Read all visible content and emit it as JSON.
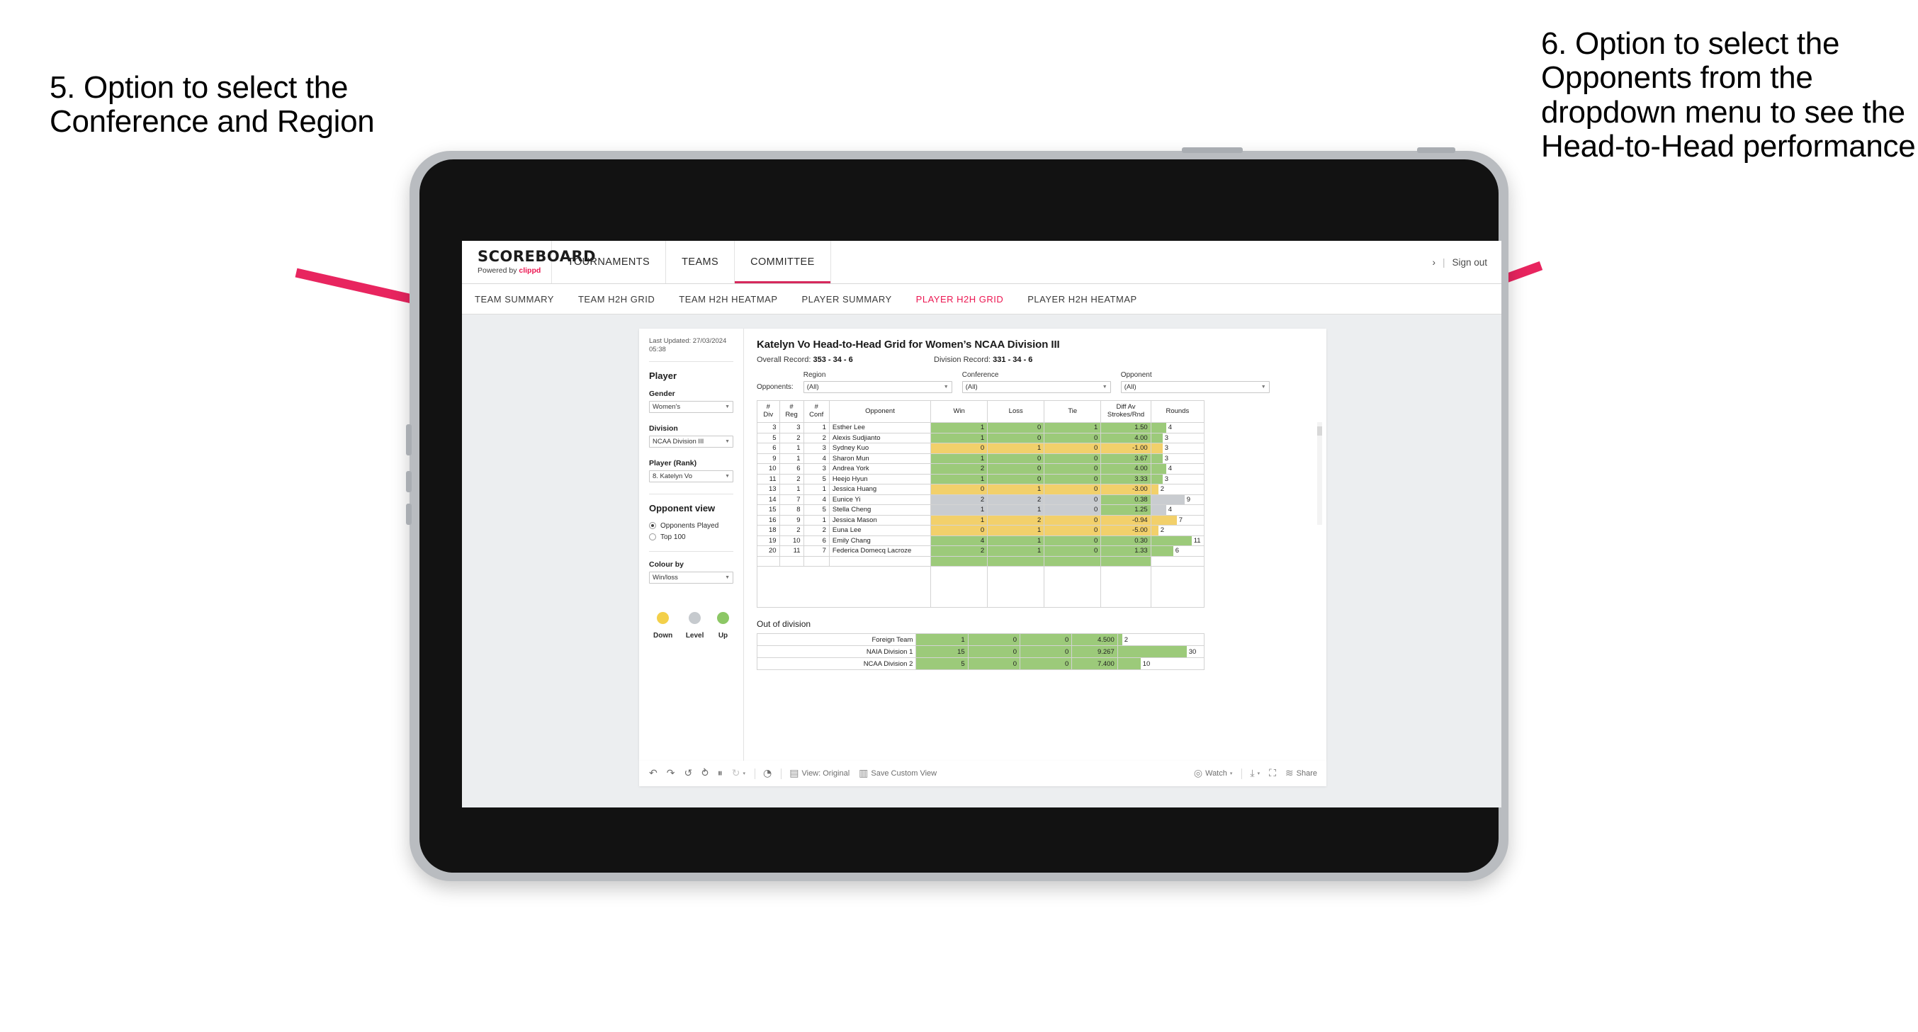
{
  "annotations": {
    "left": "5. Option to select the Conference and Region",
    "right": "6. Option to select the Opponents from the dropdown menu to see the Head-to-Head performance",
    "arrow_color": "#E8255F"
  },
  "app": {
    "logo": {
      "name": "SCOREBOARD",
      "powered_prefix": "Powered by ",
      "powered_brand": "clippd"
    },
    "topnav": [
      {
        "label": "TOURNAMENTS",
        "active": false
      },
      {
        "label": "TEAMS",
        "active": false
      },
      {
        "label": "COMMITTEE",
        "active": true
      }
    ],
    "account": {
      "chevron": "›",
      "separator": "|",
      "sign_out": "Sign out"
    },
    "subnav": [
      {
        "label": "TEAM SUMMARY",
        "active": false
      },
      {
        "label": "TEAM H2H GRID",
        "active": false
      },
      {
        "label": "TEAM H2H HEATMAP",
        "active": false
      },
      {
        "label": "PLAYER SUMMARY",
        "active": false
      },
      {
        "label": "PLAYER H2H GRID",
        "active": true
      },
      {
        "label": "PLAYER H2H HEATMAP",
        "active": false
      }
    ]
  },
  "sidebar": {
    "last_updated": "Last Updated: 27/03/2024 05:38",
    "player_heading": "Player",
    "gender": {
      "label": "Gender",
      "value": "Women's"
    },
    "division": {
      "label": "Division",
      "value": "NCAA Division III"
    },
    "player_rank": {
      "label": "Player (Rank)",
      "value": "8. Katelyn Vo"
    },
    "opponent_view": {
      "heading": "Opponent view",
      "options": [
        {
          "label": "Opponents Played",
          "selected": true
        },
        {
          "label": "Top 100",
          "selected": false
        }
      ]
    },
    "colour_by": {
      "label": "Colour by",
      "value": "Win/loss"
    },
    "legend": [
      {
        "label": "Down",
        "color": "#F3D04A"
      },
      {
        "label": "Level",
        "color": "#C6CACE"
      },
      {
        "label": "Up",
        "color": "#8CC765"
      }
    ]
  },
  "main": {
    "title": "Katelyn Vo Head-to-Head Grid for Women’s NCAA Division III",
    "overall_record_label": "Overall Record:",
    "overall_record_value": "353 - 34 - 6",
    "division_record_label": "Division Record:",
    "division_record_value": "331 -  34 - 6",
    "filters": {
      "prefix_label": "Opponents:",
      "fields": [
        {
          "title": "Region",
          "value": "(All)"
        },
        {
          "title": "Conference",
          "value": "(All)"
        },
        {
          "title": "Opponent",
          "value": "(All)"
        }
      ]
    },
    "out_of_division_title": "Out of division"
  },
  "chart_data": {
    "type": "table",
    "title": "Katelyn Vo Head-to-Head Grid for Women’s NCAA Division III",
    "columns": [
      "# Div",
      "# Reg",
      "# Conf",
      "Opponent",
      "Win",
      "Loss",
      "Tie",
      "Diff Av Strokes/Rnd",
      "Rounds"
    ],
    "column_headers_two_line": [
      [
        "#",
        "Div"
      ],
      [
        "#",
        "Reg"
      ],
      [
        "#",
        "Conf"
      ],
      [
        "Opponent",
        ""
      ],
      [
        "Win",
        ""
      ],
      [
        "Loss",
        ""
      ],
      [
        "Tie",
        ""
      ],
      [
        "Diff Av",
        "Strokes/Rnd"
      ],
      [
        "Rounds",
        ""
      ]
    ],
    "rounds_max": 12,
    "rows": [
      {
        "div": "3",
        "reg": "3",
        "conf": "1",
        "opponent": "Esther Lee",
        "win": "1",
        "loss": "0",
        "tie": "1",
        "diff": "1.50",
        "rounds": "4",
        "rounds_num": 4,
        "fill": "#9CCA7A"
      },
      {
        "div": "5",
        "reg": "2",
        "conf": "2",
        "opponent": "Alexis Sudjianto",
        "win": "1",
        "loss": "0",
        "tie": "0",
        "diff": "4.00",
        "rounds": "3",
        "rounds_num": 3,
        "fill": "#9CCA7A"
      },
      {
        "div": "6",
        "reg": "1",
        "conf": "3",
        "opponent": "Sydney Kuo",
        "win": "0",
        "loss": "1",
        "tie": "0",
        "diff": "-1.00",
        "rounds": "3",
        "rounds_num": 3,
        "fill": "#F2D06B"
      },
      {
        "div": "9",
        "reg": "1",
        "conf": "4",
        "opponent": "Sharon Mun",
        "win": "1",
        "loss": "0",
        "tie": "0",
        "diff": "3.67",
        "rounds": "3",
        "rounds_num": 3,
        "fill": "#9CCA7A"
      },
      {
        "div": "10",
        "reg": "6",
        "conf": "3",
        "opponent": "Andrea York",
        "win": "2",
        "loss": "0",
        "tie": "0",
        "diff": "4.00",
        "rounds": "4",
        "rounds_num": 4,
        "fill": "#9CCA7A"
      },
      {
        "div": "11",
        "reg": "2",
        "conf": "5",
        "opponent": "Heejo Hyun",
        "win": "1",
        "loss": "0",
        "tie": "0",
        "diff": "3.33",
        "rounds": "3",
        "rounds_num": 3,
        "fill": "#9CCA7A"
      },
      {
        "div": "13",
        "reg": "1",
        "conf": "1",
        "opponent": "Jessica Huang",
        "win": "0",
        "loss": "1",
        "tie": "0",
        "diff": "-3.00",
        "rounds": "2",
        "rounds_num": 2,
        "fill": "#F2D06B"
      },
      {
        "div": "14",
        "reg": "7",
        "conf": "4",
        "opponent": "Eunice Yi",
        "win": "2",
        "loss": "2",
        "tie": "0",
        "diff": "0.38",
        "rounds": "9",
        "rounds_num": 9,
        "fill": "#C9CCD0",
        "diff_fill": "#9CCA7A"
      },
      {
        "div": "15",
        "reg": "8",
        "conf": "5",
        "opponent": "Stella Cheng",
        "win": "1",
        "loss": "1",
        "tie": "0",
        "diff": "1.25",
        "rounds": "4",
        "rounds_num": 4,
        "fill": "#C9CCD0",
        "diff_fill": "#9CCA7A"
      },
      {
        "div": "16",
        "reg": "9",
        "conf": "1",
        "opponent": "Jessica Mason",
        "win": "1",
        "loss": "2",
        "tie": "0",
        "diff": "-0.94",
        "rounds": "7",
        "rounds_num": 7,
        "fill": "#F2D06B"
      },
      {
        "div": "18",
        "reg": "2",
        "conf": "2",
        "opponent": "Euna Lee",
        "win": "0",
        "loss": "1",
        "tie": "0",
        "diff": "-5.00",
        "rounds": "2",
        "rounds_num": 2,
        "fill": "#F2D06B"
      },
      {
        "div": "19",
        "reg": "10",
        "conf": "6",
        "opponent": "Emily Chang",
        "win": "4",
        "loss": "1",
        "tie": "0",
        "diff": "0.30",
        "rounds": "11",
        "rounds_num": 11,
        "fill": "#9CCA7A"
      },
      {
        "div": "20",
        "reg": "11",
        "conf": "7",
        "opponent": "Federica Domecq Lacroze",
        "win": "2",
        "loss": "1",
        "tie": "0",
        "diff": "1.33",
        "rounds": "6",
        "rounds_num": 6,
        "fill": "#9CCA7A"
      }
    ],
    "out_of_division": {
      "title": "Out of division",
      "rounds_max": 34,
      "rows": [
        {
          "name": "Foreign Team",
          "win": "1",
          "loss": "0",
          "tie": "0",
          "diff": "4.500",
          "rounds": "2",
          "rounds_num": 2,
          "fill": "#9CCA7A"
        },
        {
          "name": "NAIA Division 1",
          "win": "15",
          "loss": "0",
          "tie": "0",
          "diff": "9.267",
          "rounds": "30",
          "rounds_num": 30,
          "fill": "#9CCA7A"
        },
        {
          "name": "NCAA Division 2",
          "win": "5",
          "loss": "0",
          "tie": "0",
          "diff": "7.400",
          "rounds": "10",
          "rounds_num": 10,
          "fill": "#9CCA7A"
        }
      ]
    }
  },
  "toolbar": {
    "undo_icon": "↶",
    "redo_icon": "↷",
    "revert_icon": "↺",
    "refresh_icon": "⥁",
    "pause_icon": "⏸",
    "loop_icon": "↻",
    "caret": "▾",
    "alert_icon": "◔",
    "view_icon": "▤",
    "view_label": "View: Original",
    "save_icon": "▥",
    "save_label": "Save Custom View",
    "watch_icon": "◎",
    "watch_label": "Watch",
    "download_icon": "⤓",
    "fullscreen_icon": "⛶",
    "share_icon": "≋",
    "share_label": "Share"
  }
}
